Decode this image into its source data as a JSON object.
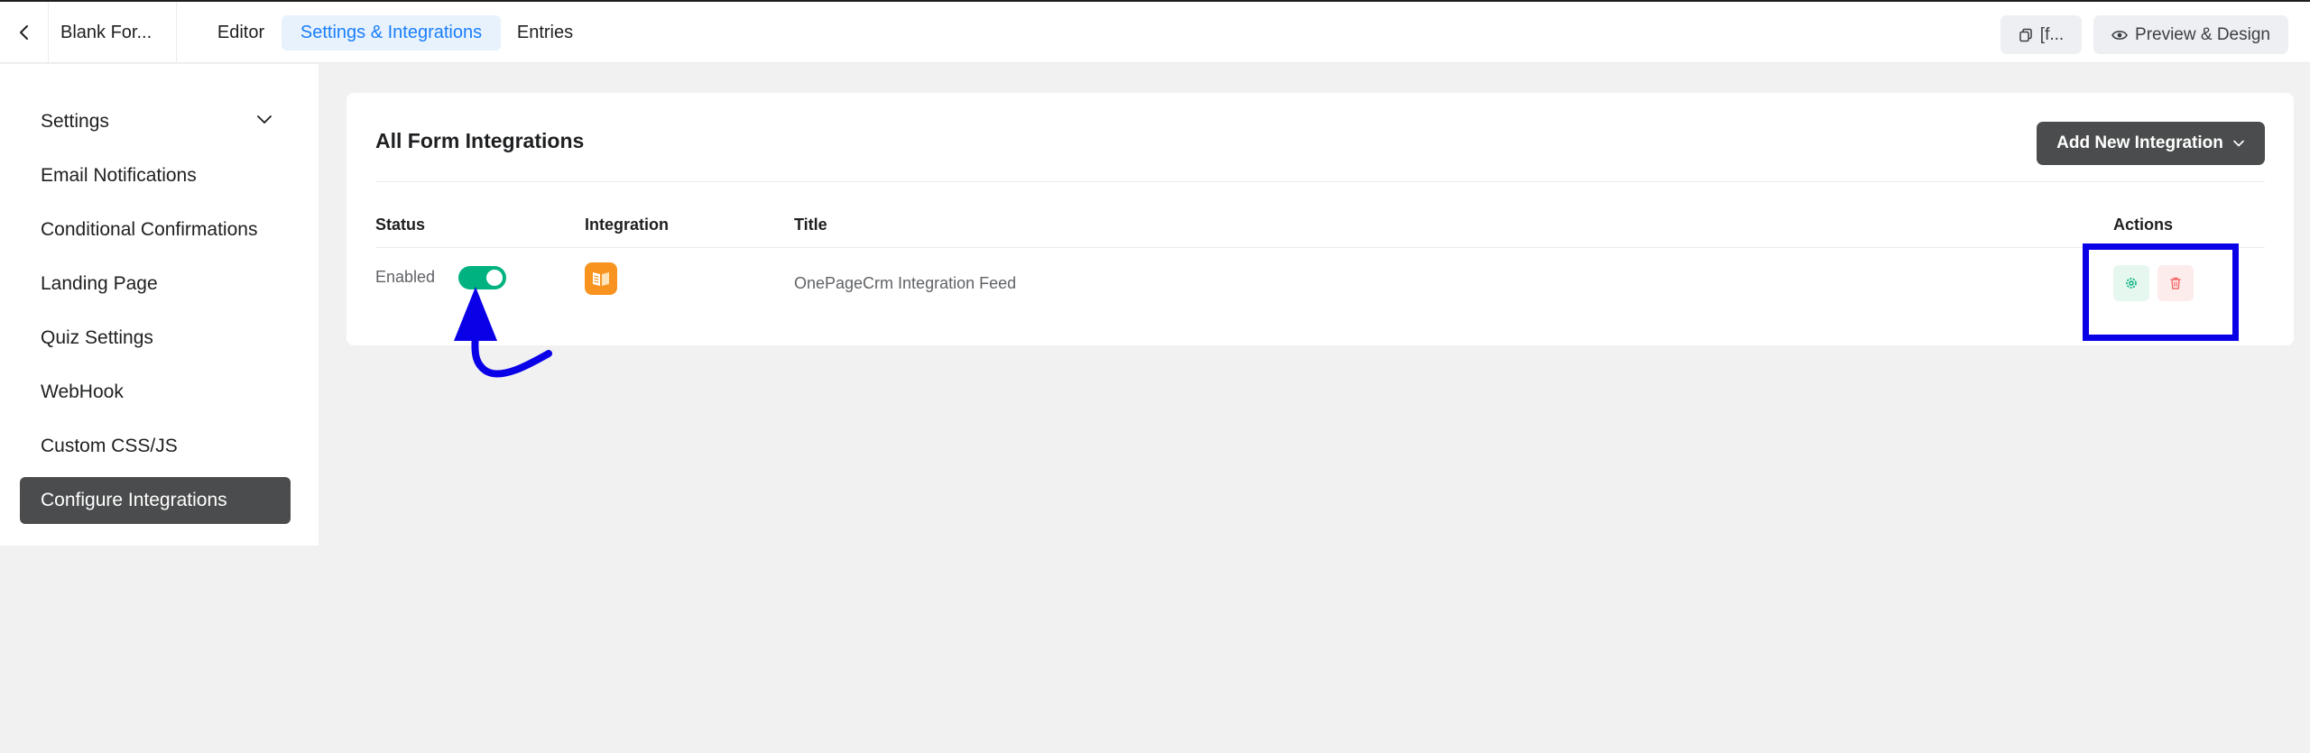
{
  "topbar": {
    "form_name": "Blank For...",
    "tabs": [
      {
        "label": "Editor",
        "active": false
      },
      {
        "label": "Settings & Integrations",
        "active": true
      },
      {
        "label": "Entries",
        "active": false
      }
    ],
    "shortcode_label": "[f...",
    "preview_label": "Preview & Design"
  },
  "sidebar": {
    "items": [
      {
        "label": "Settings",
        "has_chevron": true
      },
      {
        "label": "Email Notifications"
      },
      {
        "label": "Conditional Confirmations"
      },
      {
        "label": "Landing Page"
      },
      {
        "label": "Quiz Settings"
      },
      {
        "label": "WebHook"
      },
      {
        "label": "Custom CSS/JS"
      },
      {
        "label": "Configure Integrations",
        "active": true
      }
    ]
  },
  "main": {
    "title": "All Form Integrations",
    "add_button_label": "Add New Integration",
    "columns": {
      "status": "Status",
      "integration": "Integration",
      "title": "Title",
      "actions": "Actions"
    },
    "rows": [
      {
        "status_text": "Enabled",
        "enabled": true,
        "integration_icon": "onepagecrm-icon",
        "title": "OnePageCrm Integration Feed"
      }
    ]
  },
  "colors": {
    "accent_blue": "#1a7efb",
    "toggle_on": "#00b27f",
    "dark_button": "#4b4c4d",
    "annotation": "#0a00e8",
    "integration_orange": "#f7931e"
  }
}
